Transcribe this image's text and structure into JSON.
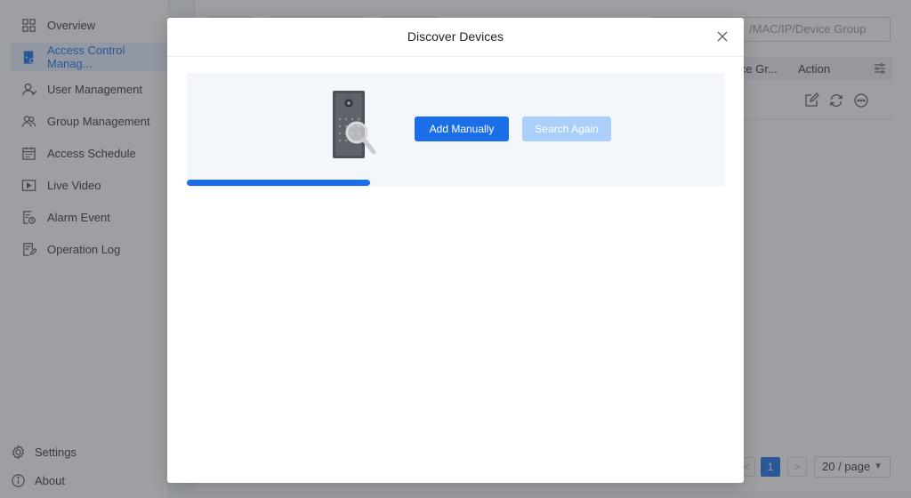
{
  "sidebar": {
    "items": [
      {
        "label": "Overview",
        "icon": "grid-icon"
      },
      {
        "label": "Access Control Manag...",
        "icon": "door-icon"
      },
      {
        "label": "User Management",
        "icon": "user-icon"
      },
      {
        "label": "Group Management",
        "icon": "users-icon"
      },
      {
        "label": "Access Schedule",
        "icon": "calendar-icon"
      },
      {
        "label": "Live Video",
        "icon": "video-icon"
      },
      {
        "label": "Alarm Event",
        "icon": "alarm-icon"
      },
      {
        "label": "Operation Log",
        "icon": "log-icon"
      }
    ],
    "active_index": 1,
    "bottom": [
      {
        "label": "Settings",
        "icon": "gear-icon"
      },
      {
        "label": "About",
        "icon": "info-icon"
      }
    ]
  },
  "main": {
    "search_placeholder": "/MAC/IP/Device Group",
    "columns": [
      "ice Gr...",
      "Action"
    ],
    "pagination": {
      "current_page": "1",
      "prev": "<",
      "next": ">",
      "page_size": "20 / page"
    }
  },
  "modal": {
    "title": "Discover Devices",
    "add_button": "Add Manually",
    "search_button": "Search Again",
    "progress": 0.34
  },
  "colors": {
    "accent": "#1a6fe8",
    "accent_disabled": "#a9cffa",
    "overlay": "rgba(60,64,72,0.5)",
    "panel": "#f3f6fb"
  }
}
